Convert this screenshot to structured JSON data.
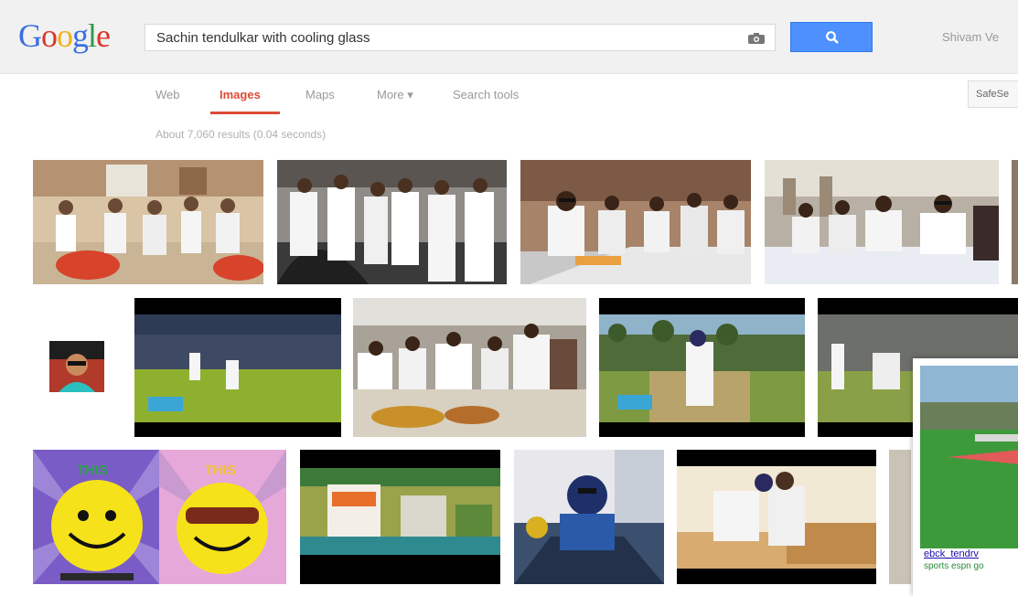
{
  "logo": {
    "letters": [
      "G",
      "o",
      "o",
      "g",
      "l",
      "e"
    ]
  },
  "search": {
    "query": "Sachin tendulkar with cooling glass"
  },
  "header": {
    "user_name": "Shivam Ve"
  },
  "nav": {
    "web": "Web",
    "images": "Images",
    "maps": "Maps",
    "more": "More ▾",
    "search_tools": "Search tools",
    "safesearch": "SafeSe"
  },
  "results_stats": "About 7,060 results (0.04 seconds)",
  "smiley": {
    "left_label": "THIS",
    "right_label": "THIS"
  },
  "hover_card": {
    "title": "ebck_tendrv",
    "subtitle": "sports espn go"
  },
  "colors": {
    "accent": "#4d90fe",
    "active_tab": "#dd4b39"
  }
}
